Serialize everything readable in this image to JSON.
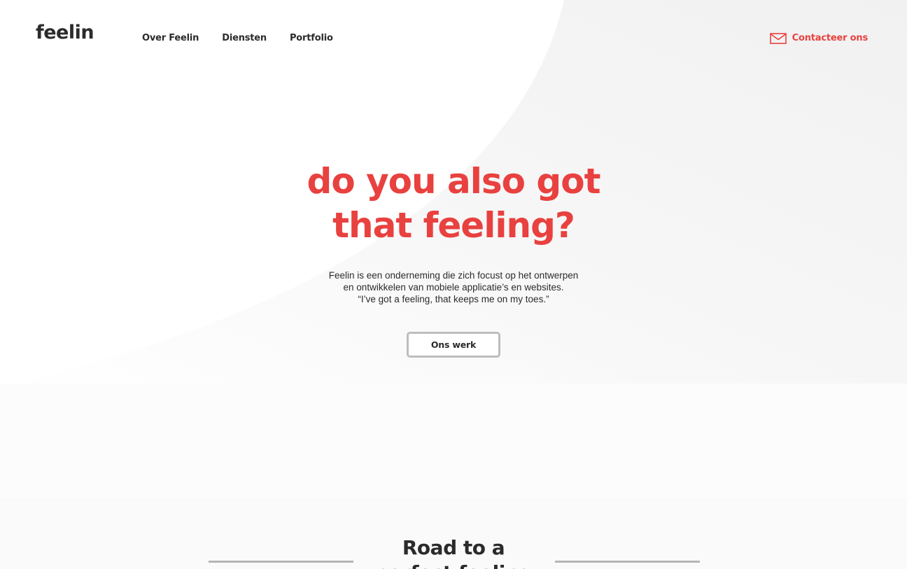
{
  "brand": {
    "logo_text": "feelin",
    "accent_color": "#e8413f",
    "text_color": "#2b2b2b"
  },
  "nav": {
    "items": [
      {
        "label": "Over Feelin"
      },
      {
        "label": "Diensten"
      },
      {
        "label": "Portfolio"
      }
    ]
  },
  "contact": {
    "icon": "mail-icon",
    "label": "Contacteer ons"
  },
  "hero": {
    "title_line1": "do you also got",
    "title_line2": "that feeling?",
    "text_line1": "Feelin is een onderneming die zich focust op het ontwerpen",
    "text_line2": "en ontwikkelen van mobiele applicatie’s en websites.",
    "text_line3": "“I’ve got a feeling, that keeps me on my toes.”",
    "cta_label": "Ons werk"
  },
  "road": {
    "title_line1": "Road to a",
    "title_line2": "perfect feeling"
  }
}
